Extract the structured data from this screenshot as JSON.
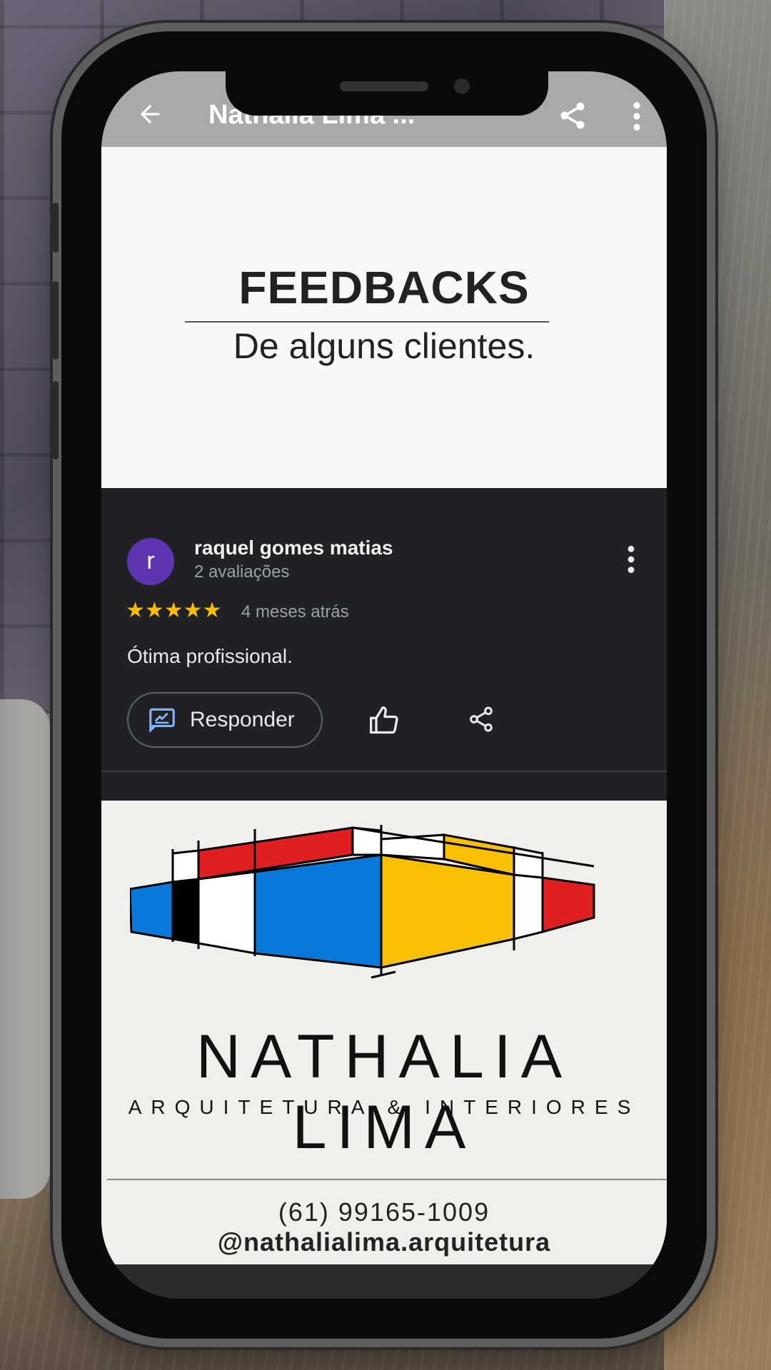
{
  "appbar": {
    "title": "Nathalia Lima ..."
  },
  "feedback_card": {
    "title": "FEEDBACKS",
    "subtitle": "De alguns clientes."
  },
  "review": {
    "avatar_letter": "r",
    "reviewer_name": "raquel gomes matias",
    "reviewer_count": "2 avaliações",
    "rating": 5,
    "stars": "★★★★★",
    "date": "4 meses atrás",
    "text": "Ótima profissional.",
    "reply_label": "Responder"
  },
  "logo_card": {
    "brand_name": "NATHALIA LIMA",
    "brand_sub": "ARQUITETURA & INTERIORES",
    "phone": "(61) 99165-1009",
    "instagram": "@nathalialima.arquitetura"
  },
  "colors": {
    "star": "#fbbc04",
    "avatar": "#5e35b1",
    "logo_red": "#e02020",
    "logo_blue": "#0a78d8",
    "logo_yellow": "#f8c000"
  },
  "icons": [
    "back-arrow-icon",
    "share-icon",
    "more-vert-icon",
    "reply-icon",
    "thumbs-up-icon"
  ]
}
